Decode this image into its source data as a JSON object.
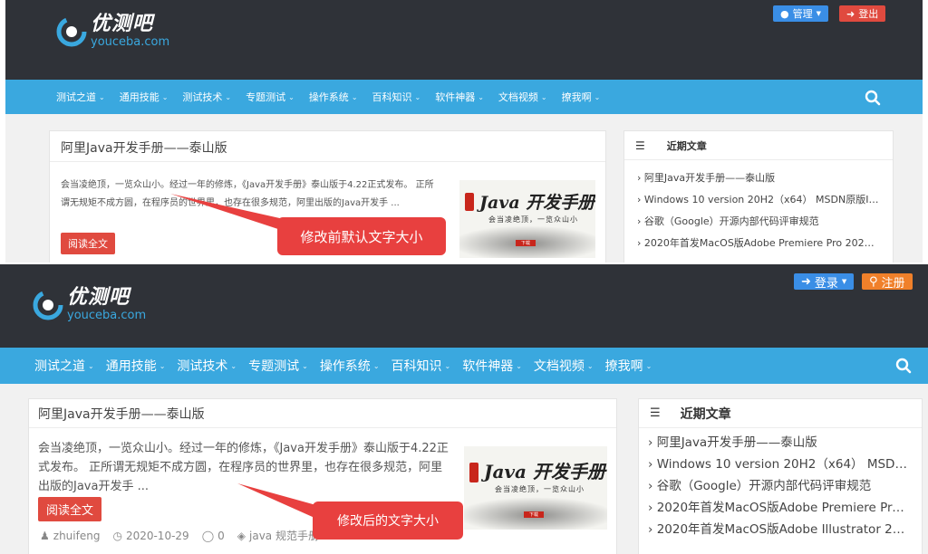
{
  "logo": {
    "cn": "优测吧",
    "en": "youceba.com"
  },
  "top": {
    "buttons": {
      "admin": "管理",
      "logout": "登出"
    },
    "nav": [
      "测试之道",
      "通用技能",
      "测试技术",
      "专题测试",
      "操作系统",
      "百科知识",
      "软件神器",
      "文档视频",
      "撩我啊"
    ],
    "post": {
      "title": "阿里Java开发手册——泰山版",
      "excerpt": "会当凌绝顶，一览众山小。经过一年的修炼，《Java开发手册》泰山版于4.22正式发布。 正所谓无规矩不成方圆，在程序员的世界里，也存在很多规范，阿里出版的Java开发手 ...",
      "read_more": "阅读全文"
    },
    "sidebar": {
      "title": "近期文章",
      "items": [
        "› 阿里Java开发手册——泰山版",
        "› Windows 10 version 20H2（x64） MSDN原版IS...",
        "› 谷歌（Google）开源内部代码评审规范",
        "› 2020年首发MacOS版Adobe Premiere Pro 2021-..."
      ]
    },
    "callout": "修改前默认文字大小"
  },
  "bottom": {
    "buttons": {
      "login": "登录",
      "register": "注册"
    },
    "nav": [
      "测试之道",
      "通用技能",
      "测试技术",
      "专题测试",
      "操作系统",
      "百科知识",
      "软件神器",
      "文档视频",
      "撩我啊"
    ],
    "post": {
      "title": "阿里Java开发手册——泰山版",
      "excerpt": "会当凌绝顶，一览众山小。经过一年的修炼，《Java开发手册》泰山版于4.22正式发布。 正所谓无规矩不成方圆，在程序员的世界里，也存在很多规范，阿里出版的Java开发手 ...",
      "read_more": "阅读全文",
      "meta": {
        "author": "zhuifeng",
        "date": "2020-10-29",
        "comments": "0",
        "tags": "java 规范手册"
      }
    },
    "sidebar": {
      "title": "近期文章",
      "items": [
        "› 阿里Java开发手册——泰山版",
        "› Windows 10 version 20H2（x64） MSDN...",
        "› 谷歌（Google）开源内部代码评审规范",
        "› 2020年首发MacOS版Adobe Premiere Pro ...",
        "› 2020年首发MacOS版Adobe Illustrator 202..."
      ]
    },
    "callout": "修改后的文字大小"
  },
  "thumb": {
    "title": "Java 开发手册",
    "subtitle": "会当凌绝顶，一览众山小",
    "download": "下载"
  },
  "colors": {
    "header": "#2f3238",
    "nav": "#3aa8df",
    "red": "#e04a3f",
    "blue": "#3a8ee6",
    "orange": "#f0802a"
  }
}
